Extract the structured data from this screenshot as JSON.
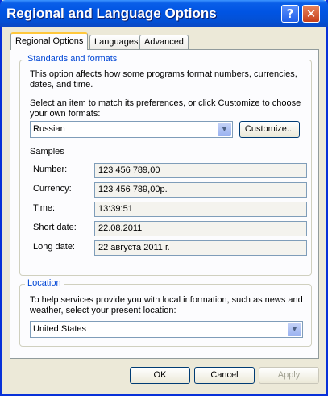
{
  "window": {
    "title": "Regional and Language Options",
    "help_glyph": "?",
    "close_glyph": "✕"
  },
  "tabs": [
    {
      "label": "Regional Options",
      "active": true
    },
    {
      "label": "Languages",
      "active": false
    },
    {
      "label": "Advanced",
      "active": false
    }
  ],
  "standards": {
    "group_title": "Standards and formats",
    "description_line1": "This option affects how some programs format numbers, currencies,",
    "description_line2": "dates, and time.",
    "select_line1": "Select an item to match its preferences, or click Customize to choose",
    "select_line2": "your own formats:",
    "format_value": "Russian",
    "customize_label": "Customize...",
    "samples_label": "Samples",
    "samples": [
      {
        "label": "Number:",
        "value": "123 456 789,00"
      },
      {
        "label": "Currency:",
        "value": "123 456 789,00р."
      },
      {
        "label": "Time:",
        "value": "13:39:51"
      },
      {
        "label": "Short date:",
        "value": "22.08.2011"
      },
      {
        "label": "Long date:",
        "value": "22 августа 2011 г."
      }
    ]
  },
  "location": {
    "group_title": "Location",
    "description_line1": "To help services provide you with local information, such as news and",
    "description_line2": "weather, select your present location:",
    "value": "United States"
  },
  "buttons": {
    "ok": "OK",
    "cancel": "Cancel",
    "apply": "Apply"
  },
  "icons": {
    "dropdown": "▼"
  }
}
